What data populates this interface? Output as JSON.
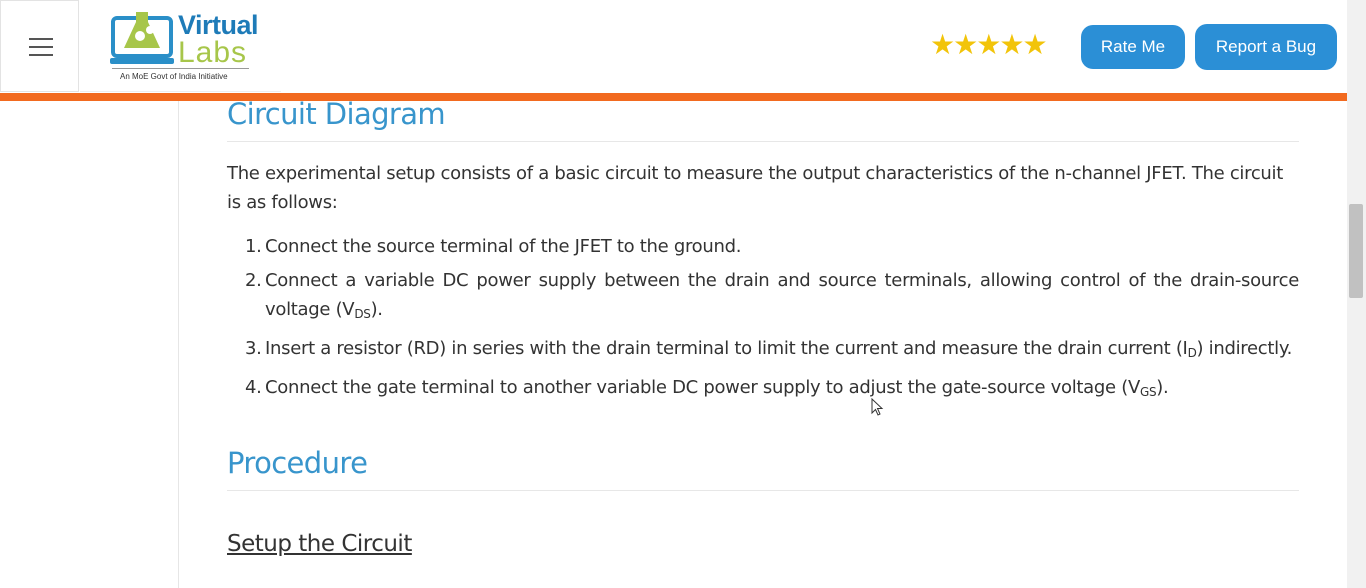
{
  "header": {
    "logo_top": "Virtual",
    "logo_bottom": "Labs",
    "logo_tagline": "An MoE Govt of India Initiative",
    "rating_stars": 5,
    "rate_button": "Rate Me",
    "bug_button": "Report a Bug"
  },
  "colors": {
    "accent_orange": "#f26a1f",
    "button_blue": "#2b8fd6",
    "heading_blue": "#3895cc",
    "star_gold": "#f2c40a"
  },
  "circuit": {
    "heading": "Circuit Diagram",
    "intro": "The experimental setup consists of a basic circuit to measure the output characteristics of the n-channel JFET. The circuit is as follows:",
    "steps": [
      {
        "num": "1.",
        "text": "Connect the source terminal of the JFET to the ground."
      },
      {
        "num": "2.",
        "text_a": "Connect a variable DC power supply between the drain and source terminals, allowing control of the drain-source voltage (V",
        "sub": "DS",
        "text_b": ")."
      },
      {
        "num": "3.",
        "text_a": "Insert a resistor (RD) in series with the drain terminal to limit the current and measure the drain current (I",
        "sub": "D",
        "text_b": ") indirectly."
      },
      {
        "num": "4.",
        "text_a": "Connect the gate terminal to another variable DC power supply to adjust the gate-source voltage (V",
        "sub": "GS",
        "text_b": ")."
      }
    ]
  },
  "procedure": {
    "heading": "Procedure",
    "subheading": "Setup the Circuit"
  }
}
